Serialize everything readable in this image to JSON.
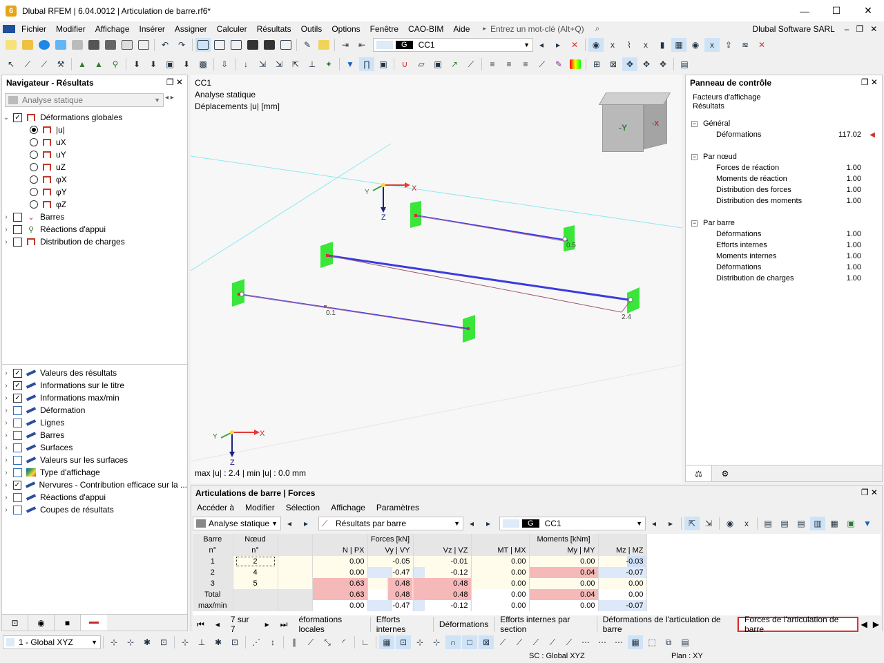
{
  "window": {
    "title": "Dlubal RFEM | 6.04.0012 | Articulation de barre.rf6*",
    "minimize": "—",
    "maximize": "☐",
    "close": "✕"
  },
  "menu": {
    "items": [
      "Fichier",
      "Modifier",
      "Affichage",
      "Insérer",
      "Assigner",
      "Calculer",
      "Résultats",
      "Outils",
      "Options",
      "Fenêtre",
      "CAO-BIM",
      "Aide"
    ],
    "search_placeholder": "Entrez un mot-clé (Alt+Q)",
    "company": "Dlubal Software SARL"
  },
  "toolbar": {
    "load_case_tag": "G",
    "load_case": "CC1"
  },
  "navigator": {
    "title": "Navigateur - Résultats",
    "combo": "Analyse statique",
    "tree": [
      {
        "label": "Déformations globales",
        "checked": true,
        "expanded": true
      },
      {
        "label": "|u|",
        "radio": true,
        "on": true
      },
      {
        "label": "uX",
        "radio": true
      },
      {
        "label": "uY",
        "radio": true
      },
      {
        "label": "uZ",
        "radio": true
      },
      {
        "label": "φX",
        "radio": true
      },
      {
        "label": "φY",
        "radio": true
      },
      {
        "label": "φZ",
        "radio": true
      },
      {
        "label": "Barres",
        "checked": false
      },
      {
        "label": "Réactions d'appui",
        "checked": false
      },
      {
        "label": "Distribution de charges",
        "checked": false
      }
    ],
    "tree2": [
      {
        "label": "Valeurs des résultats",
        "checked": true
      },
      {
        "label": "Informations sur le titre",
        "checked": true
      },
      {
        "label": "Informations max/min",
        "checked": true
      },
      {
        "label": "Déformation",
        "checked": false
      },
      {
        "label": "Lignes",
        "checked": false
      },
      {
        "label": "Barres",
        "checked": false
      },
      {
        "label": "Surfaces",
        "checked": false
      },
      {
        "label": "Valeurs sur les surfaces",
        "checked": false
      },
      {
        "label": "Type d'affichage",
        "checked": false
      },
      {
        "label": "Nervures - Contribution efficace sur la ...",
        "checked": true
      },
      {
        "label": "Réactions d'appui",
        "checked": false
      },
      {
        "label": "Coupes de résultats",
        "checked": false
      }
    ]
  },
  "viewport": {
    "info_lines": [
      "CC1",
      "Analyse statique",
      "Déplacements |u| [mm]"
    ],
    "maxmin": "max |u| : 2.4 | min |u| : 0.0 mm",
    "labels": {
      "x": "X",
      "y": "Y",
      "z": "Z",
      "v05": "0.5",
      "v01": "0.1",
      "v24": "2.4"
    },
    "cube": {
      "y": "-Y",
      "x": "-X"
    }
  },
  "control_panel": {
    "title": "Panneau de contrôle",
    "subtitle1": "Facteurs d'affichage",
    "subtitle2": "Résultats",
    "sections": [
      {
        "name": "Général",
        "rows": [
          {
            "label": "Déformations",
            "value": "117.02"
          }
        ]
      },
      {
        "name": "Par nœud",
        "rows": [
          {
            "label": "Forces de réaction",
            "value": "1.00"
          },
          {
            "label": "Moments de réaction",
            "value": "1.00"
          },
          {
            "label": "Distribution des forces",
            "value": "1.00"
          },
          {
            "label": "Distribution des moments",
            "value": "1.00"
          }
        ]
      },
      {
        "name": "Par barre",
        "rows": [
          {
            "label": "Déformations",
            "value": "1.00"
          },
          {
            "label": "Efforts internes",
            "value": "1.00"
          },
          {
            "label": "Moments internes",
            "value": "1.00"
          },
          {
            "label": "Déformations",
            "value": "1.00"
          },
          {
            "label": "Distribution de charges",
            "value": "1.00"
          }
        ]
      }
    ]
  },
  "bottom": {
    "title": "Articulations de barre | Forces",
    "menu": [
      "Accéder à",
      "Modifier",
      "Sélection",
      "Affichage",
      "Paramètres"
    ],
    "combo1": "Analyse statique",
    "combo2": "Résultats par barre",
    "lc_tag": "G",
    "lc": "CC1",
    "headers": {
      "barre": "Barre",
      "barre_n": "n°",
      "noeud": "Nœud",
      "noeud_n": "n°",
      "forces": "Forces [kN]",
      "moments": "Moments [kNm]",
      "n": "N | PX",
      "vy": "Vy | VY",
      "vz": "Vz | VZ",
      "mt": "MT | MX",
      "my": "My | MY",
      "mz": "Mz | MZ"
    },
    "rows": [
      {
        "barre": "1",
        "noeud": "2",
        "n": "0.00",
        "vy": "-0.05",
        "vz": "-0.01",
        "mt": "0.00",
        "my": "0.00",
        "mz": "-0.03"
      },
      {
        "barre": "2",
        "noeud": "4",
        "n": "0.00",
        "vy": "-0.47",
        "vz": "-0.12",
        "mt": "0.00",
        "my": "0.04",
        "mz": "-0.07"
      },
      {
        "barre": "3",
        "noeud": "5",
        "n": "0.63",
        "vy": "0.48",
        "vz": "0.48",
        "mt": "0.00",
        "my": "0.00",
        "mz": "0.00"
      },
      {
        "barre": "Total",
        "noeud": "",
        "n": "0.63",
        "vy": "0.48",
        "vz": "0.48",
        "mt": "0.00",
        "my": "0.04",
        "mz": "0.00"
      },
      {
        "barre": "max/min",
        "noeud": "",
        "n": "0.00",
        "vy": "-0.47",
        "vz": "-0.12",
        "mt": "0.00",
        "my": "0.00",
        "mz": "-0.07"
      }
    ],
    "pager": "7 sur 7",
    "tabs": [
      "éformations locales",
      "Efforts internes",
      "Déformations",
      "Efforts internes par section",
      "Déformations de l'articulation de barre",
      "Forces de l'articulation de barre"
    ]
  },
  "statusbar": {
    "cs": "1 - Global XYZ",
    "sc": "SC : Global XYZ",
    "plan": "Plan : XY"
  }
}
